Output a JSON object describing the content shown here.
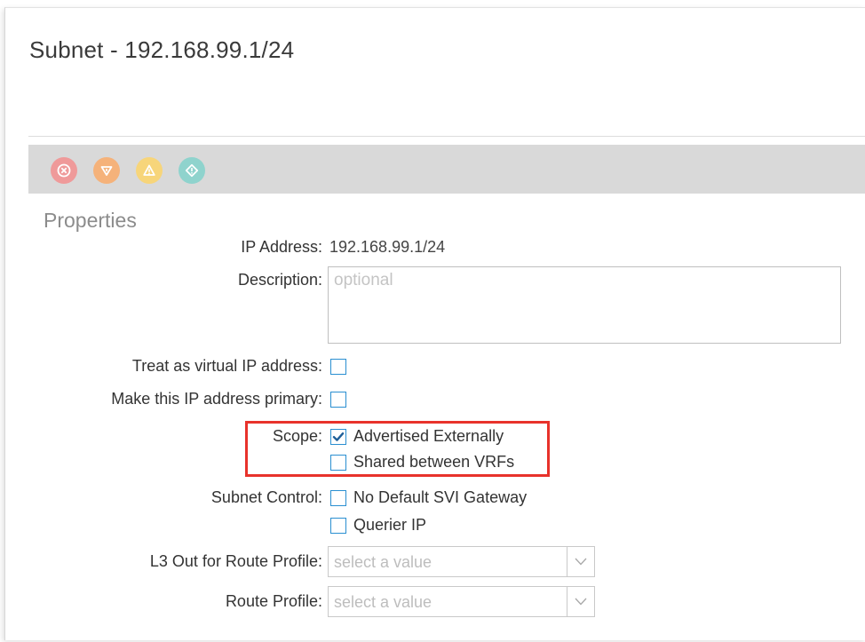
{
  "header": {
    "title": "Subnet - 192.168.99.1/24"
  },
  "toolbar": {
    "icons": [
      {
        "name": "critical-fault-icon",
        "color": "#ef9a9a"
      },
      {
        "name": "major-fault-icon",
        "color": "#f5b27a"
      },
      {
        "name": "minor-fault-icon",
        "color": "#f7d57a"
      },
      {
        "name": "warning-fault-icon",
        "color": "#8fd3cd"
      }
    ]
  },
  "properties": {
    "section_title": "Properties",
    "ip_address": {
      "label": "IP Address:",
      "value": "192.168.99.1/24"
    },
    "description": {
      "label": "Description:",
      "value": "",
      "placeholder": "optional"
    },
    "virtual_ip": {
      "label": "Treat as virtual IP address:",
      "checked": false
    },
    "primary_ip": {
      "label": "Make this IP address primary:",
      "checked": false
    },
    "scope": {
      "label": "Scope:",
      "options": [
        {
          "label": "Advertised Externally",
          "checked": true
        },
        {
          "label": "Shared between VRFs",
          "checked": false
        }
      ]
    },
    "subnet_control": {
      "label": "Subnet Control:",
      "options": [
        {
          "label": "No Default SVI Gateway",
          "checked": false
        },
        {
          "label": "Querier IP",
          "checked": false
        }
      ]
    },
    "l3out_route_profile": {
      "label": "L3 Out for Route Profile:",
      "placeholder": "select a value"
    },
    "route_profile": {
      "label": "Route Profile:",
      "placeholder": "select a value"
    }
  },
  "colors": {
    "checkbox_border": "#2a8fd1",
    "highlight": "#e8322b",
    "toolbar_bg": "#d9d9d9"
  }
}
